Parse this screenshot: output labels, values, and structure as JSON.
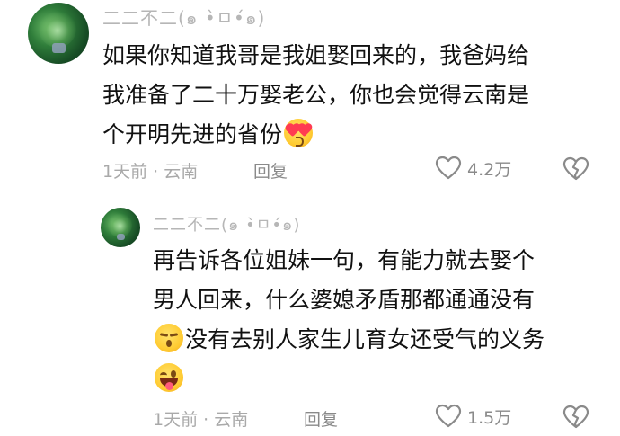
{
  "comments": [
    {
      "username": "二二不二(๑ •̀ㅁ•́๑)",
      "lines": [
        "如果你知道我哥是我姐娶回来的，我爸妈给",
        "我准备了二十万娶老公，你也会觉得云南是",
        "个开明先进的省份"
      ],
      "emoji": "heart-eyes-emoji",
      "time": "1天前",
      "location": "云南",
      "reply_label": "回复",
      "likes": "4.2万"
    },
    {
      "username": "二二不二(๑ •̀ㅁ•́๑)",
      "lines": [
        "再告诉各位姐妹一句，有能力就去娶个",
        "男人回来，什么婆媳矛盾那都通通没有",
        "没有去别人家生儿育女还受气的义务"
      ],
      "emojis": [
        "smirk-emoji",
        "wink-tongue-emoji"
      ],
      "time": "1天前",
      "location": "云南",
      "reply_label": "回复",
      "likes": "1.5万"
    }
  ],
  "separator": "·",
  "colors": {
    "meta": "#a9a9a9",
    "username": "#b6b6b6",
    "text": "#111111"
  }
}
